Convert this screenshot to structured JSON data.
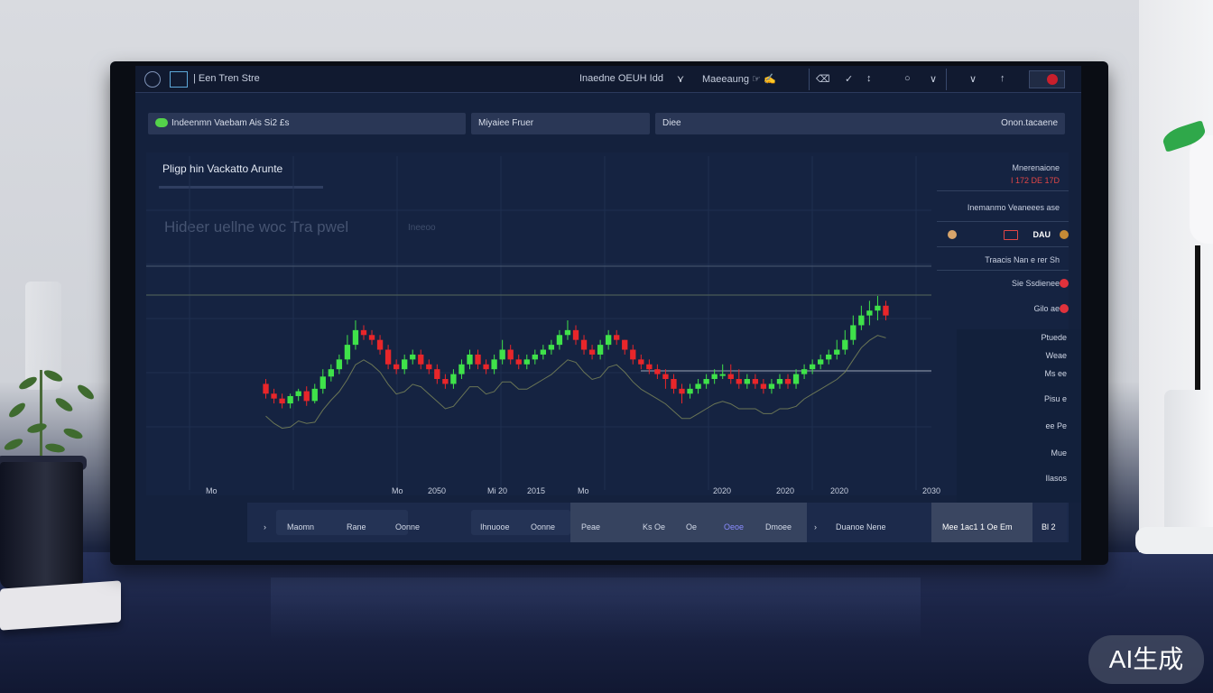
{
  "topbar": {
    "left_title": "| Een Tren Stre",
    "center_1": "Inaedne OEUH Idd",
    "center_2": "Maeeaung ☞ ✍",
    "right_icons": [
      "⌫",
      "✓",
      "↕",
      "○",
      "∨",
      "∨",
      "↑"
    ]
  },
  "filters": {
    "pill_1": "Indeenmn Vaebam Ais Si2 £s",
    "pill_2": "Miyaiee Fruer",
    "pill_3": "Diee",
    "pill_4": "Onon.tacaene"
  },
  "panel": {
    "title": "Pligp hin Vackatto Arunte",
    "ghost_title": "Hideer uellne woc Tra pwel",
    "ghost_sub": "Ineeoo"
  },
  "side": {
    "header": "Mnerenaione",
    "header_red": "I 172 DE 17D",
    "row_1": "Inemanmo Veaneees ase",
    "row_2": "DAU",
    "row_3": "Traacis Nan e rer Sh",
    "row_4": "Sie Ssdienee",
    "row_5": "Gilo ae",
    "lower": [
      "Ptuede",
      "Weae",
      "Ms ee",
      "Pisu e",
      "ee Pe",
      "Mue",
      "Ilasos"
    ]
  },
  "x_ticks": [
    "Mo",
    "Mo",
    "2050",
    "Mi 20",
    "2015",
    "Mo",
    "2020",
    "2020",
    "2020",
    "2030"
  ],
  "bottom_bar": {
    "btn_1": "Maomn",
    "btn_2": "Rane",
    "btn_3": "Oonne",
    "btn_4": "Ihnuooe",
    "btn_5": "Oonne",
    "btn_6": "Peae",
    "btn_7": "Ks Oe",
    "btn_8": "Oe",
    "btn_9": "Oeoe",
    "btn_10": "Dmoee",
    "btn_11": "Duanoe Nene",
    "btn_12": "Mee 1ac1 1 Oe Em",
    "btn_13": "Bl 2"
  },
  "badge": "AI生成",
  "chart_data": {
    "type": "candlestick",
    "up_color": "#3fe24a",
    "down_color": "#e8262a",
    "ylim": [
      0,
      100
    ],
    "open": [
      52,
      48,
      46,
      44,
      47,
      49,
      45,
      50,
      55,
      58,
      62,
      68,
      74,
      72,
      70,
      66,
      60,
      58,
      62,
      64,
      60,
      58,
      54,
      52,
      56,
      60,
      64,
      60,
      58,
      62,
      66,
      62,
      60,
      62,
      64,
      66,
      68,
      72,
      74,
      70,
      66,
      64,
      68,
      72,
      70,
      66,
      62,
      60,
      58,
      56,
      54,
      50,
      48,
      50,
      52,
      54,
      56,
      56,
      54,
      52,
      54,
      52,
      50,
      52,
      54,
      52,
      56,
      58,
      60,
      62,
      64,
      66,
      70,
      76,
      80,
      82,
      84
    ],
    "close": [
      48,
      46,
      44,
      47,
      49,
      45,
      50,
      55,
      58,
      62,
      68,
      74,
      72,
      70,
      66,
      60,
      58,
      62,
      64,
      60,
      58,
      54,
      52,
      56,
      60,
      64,
      60,
      58,
      62,
      66,
      62,
      60,
      62,
      64,
      66,
      68,
      72,
      74,
      70,
      66,
      64,
      68,
      72,
      70,
      66,
      62,
      60,
      58,
      56,
      54,
      50,
      48,
      50,
      52,
      54,
      56,
      56,
      54,
      52,
      54,
      52,
      50,
      52,
      54,
      52,
      56,
      58,
      60,
      62,
      64,
      66,
      70,
      76,
      80,
      82,
      84,
      80
    ],
    "high": [
      54,
      50,
      48,
      48,
      50,
      51,
      52,
      58,
      60,
      64,
      72,
      78,
      76,
      74,
      72,
      68,
      62,
      64,
      66,
      66,
      62,
      60,
      56,
      58,
      62,
      66,
      66,
      62,
      64,
      70,
      68,
      64,
      64,
      66,
      68,
      70,
      74,
      78,
      76,
      72,
      68,
      70,
      74,
      74,
      70,
      68,
      64,
      62,
      60,
      58,
      56,
      52,
      52,
      54,
      56,
      58,
      60,
      60,
      58,
      56,
      56,
      54,
      54,
      56,
      56,
      58,
      60,
      62,
      64,
      66,
      70,
      74,
      80,
      84,
      86,
      88,
      86
    ],
    "low": [
      46,
      44,
      42,
      42,
      45,
      43,
      44,
      48,
      53,
      56,
      60,
      66,
      70,
      68,
      64,
      58,
      56,
      56,
      60,
      58,
      56,
      52,
      50,
      50,
      54,
      58,
      58,
      56,
      56,
      60,
      60,
      58,
      58,
      60,
      62,
      64,
      66,
      70,
      68,
      64,
      62,
      62,
      66,
      68,
      64,
      60,
      58,
      56,
      54,
      50,
      48,
      44,
      46,
      48,
      50,
      52,
      54,
      52,
      50,
      50,
      50,
      48,
      48,
      50,
      50,
      50,
      54,
      56,
      58,
      60,
      62,
      64,
      68,
      74,
      76,
      78,
      78
    ]
  }
}
